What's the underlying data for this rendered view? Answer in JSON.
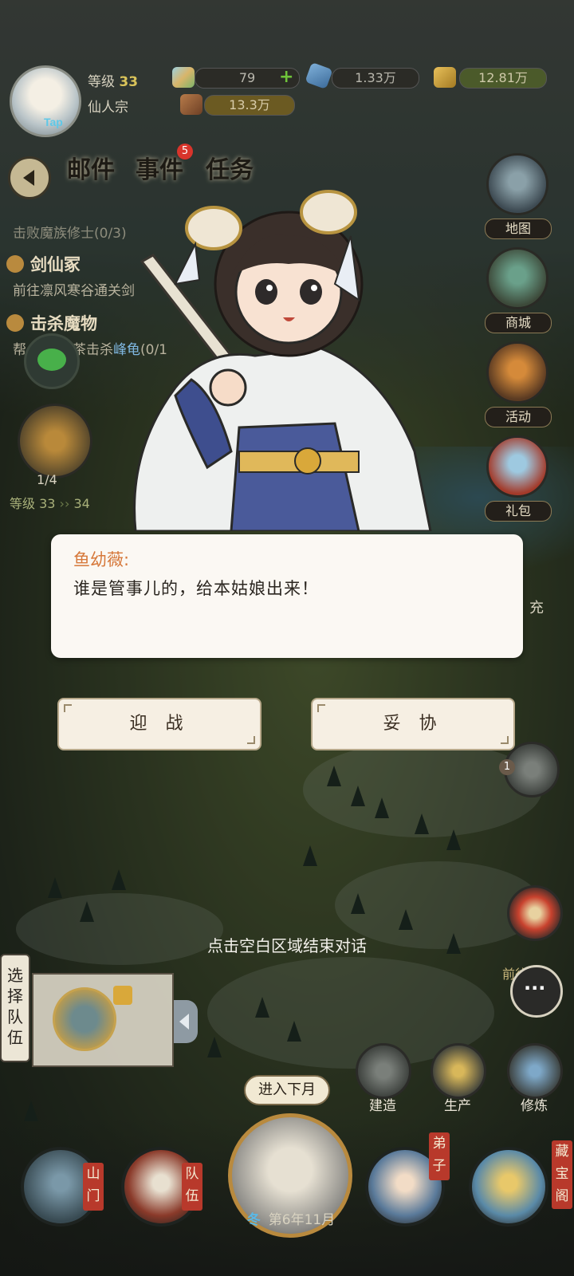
{
  "player": {
    "avatar_tap": "Tap",
    "level_label": "等级",
    "level": "33",
    "sect": "仙人宗"
  },
  "resources": {
    "spirit_stone": "79",
    "crystal": "1.33万",
    "gold": "12.81万",
    "wood": "13.3万"
  },
  "tabs": {
    "mail": "邮件",
    "events": "事件",
    "events_badge": "5",
    "tasks": "任务"
  },
  "quests": [
    {
      "title": "",
      "desc": "击败魔族修士(0/3)"
    },
    {
      "title": "剑仙冢",
      "desc": "前往凛风寒谷通关剑",
      "highlight": ""
    },
    {
      "title": "击杀魔物",
      "desc": "帮",
      "highlight": "峰龟",
      "desc_pre": "茶击杀",
      "progress": "(0/1"
    }
  ],
  "left_building": {
    "count": "1/4",
    "level_text": "等级 33",
    "next_level": "34"
  },
  "side_menu": [
    {
      "label": "地图"
    },
    {
      "label": "商城"
    },
    {
      "label": "活动"
    },
    {
      "label": "礼包"
    },
    {
      "label": "充"
    }
  ],
  "dialog": {
    "speaker": "鱼幼薇:",
    "line": "谁是管事儿的，给本姑娘出来！",
    "choice_fight": "迎 战",
    "choice_yield": "妥 协"
  },
  "hint": "点击空白区域结束对话",
  "team": {
    "select_label_1": "选",
    "select_label_2": "择",
    "select_label_3": "队",
    "select_label_4": "伍"
  },
  "actions": {
    "travel": "前往游",
    "build": "建造",
    "produce": "生产",
    "cultivate": "修炼",
    "notify_count": "1"
  },
  "bottom_nav": {
    "gate": [
      "山",
      "门"
    ],
    "team": [
      "队",
      "伍"
    ],
    "disciple": [
      "弟",
      "子"
    ],
    "treasure": [
      "藏",
      "宝",
      "阁"
    ],
    "next_month": "进入下月",
    "season": "冬",
    "date": "第6年11月"
  },
  "colors": {
    "dialog_bg": "#fbf8f3",
    "speaker": "#d6783a",
    "accent_gold": "#b98a3e",
    "nav_tag": "#b8392b"
  }
}
